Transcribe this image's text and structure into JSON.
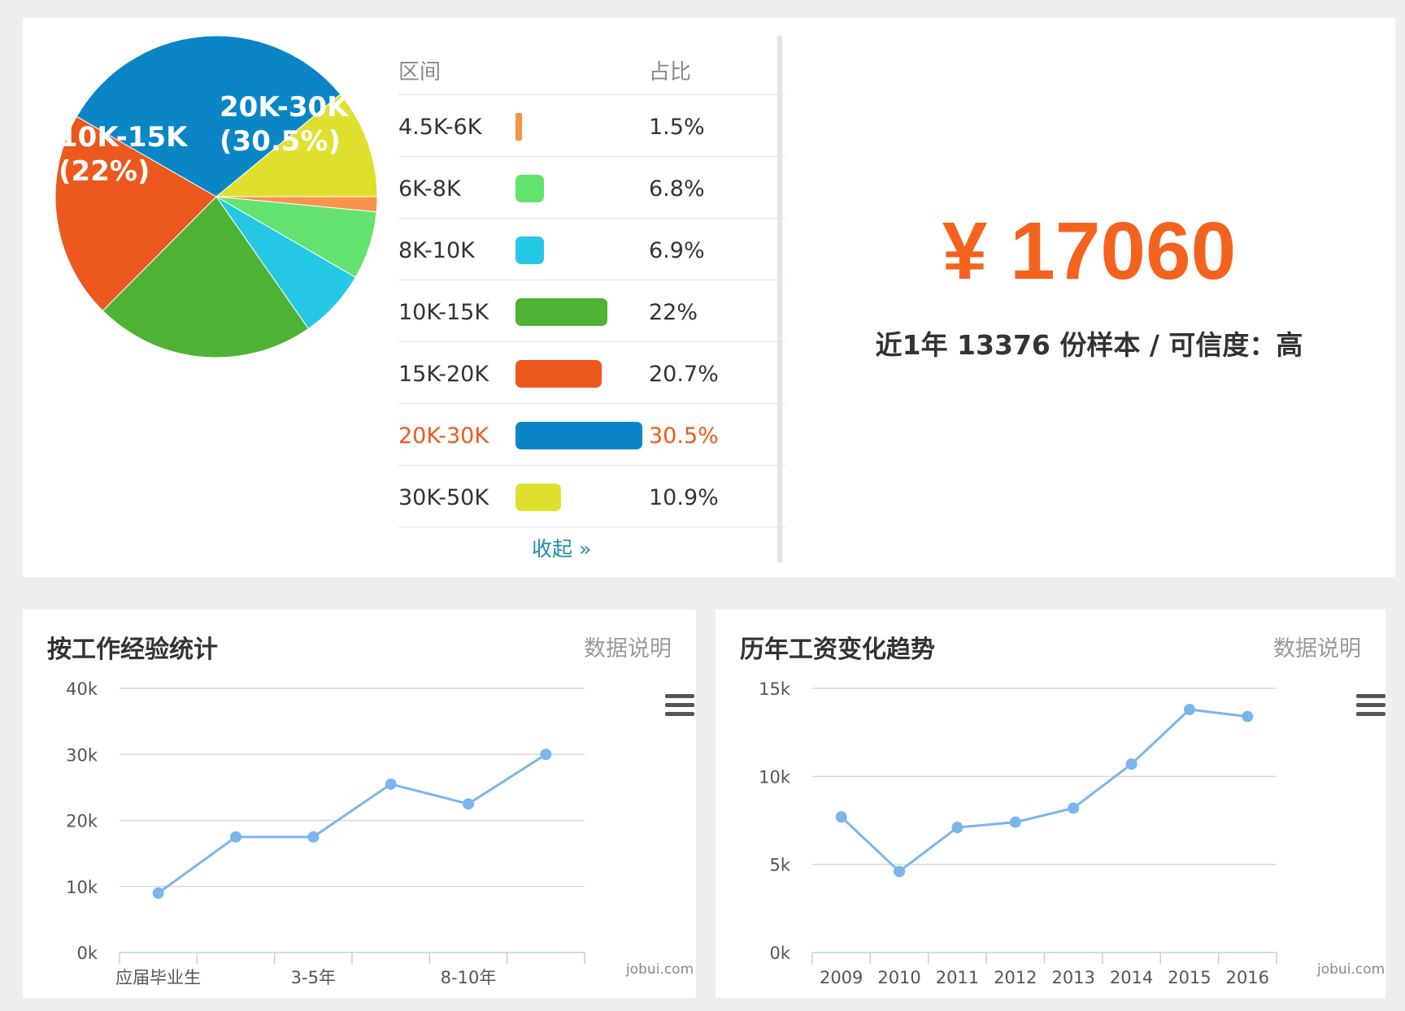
{
  "distribution": {
    "table_headers": {
      "range": "区间",
      "ratio": "占比"
    },
    "rows": [
      {
        "label": "4.5K-6K",
        "pct_text": "1.5%",
        "value": 1.5,
        "color": "#f7934a",
        "highlight": false
      },
      {
        "label": "6K-8K",
        "pct_text": "6.8%",
        "value": 6.8,
        "color": "#64e26f",
        "highlight": false
      },
      {
        "label": "8K-10K",
        "pct_text": "6.9%",
        "value": 6.9,
        "color": "#25c9e5",
        "highlight": false
      },
      {
        "label": "10K-15K",
        "pct_text": "22%",
        "value": 22,
        "color": "#4eb234",
        "highlight": false
      },
      {
        "label": "15K-20K",
        "pct_text": "20.7%",
        "value": 20.7,
        "color": "#ec581e",
        "highlight": false
      },
      {
        "label": "20K-30K",
        "pct_text": "30.5%",
        "value": 30.5,
        "color": "#0a86c7",
        "highlight": true
      },
      {
        "label": "30K-50K",
        "pct_text": "10.9%",
        "value": 10.9,
        "color": "#dfe02d",
        "highlight": false
      }
    ],
    "pie_labels": {
      "a_name": "20K-30K",
      "a_pct": "(30.5%)",
      "b_name": "10K-15K",
      "b_pct": "(22%)"
    },
    "collapse_label": "收起 »"
  },
  "summary": {
    "salary": "¥ 17060",
    "sample_text": "近1年 13376 份样本 / 可信度：高"
  },
  "experience_chart": {
    "title": "按工作经验统计",
    "note": "数据说明",
    "watermark": "jobui.com"
  },
  "trend_chart": {
    "title": "历年工资变化趋势",
    "note": "数据说明",
    "watermark": "jobui.com"
  },
  "chart_data": [
    {
      "type": "pie",
      "labels": [
        "4.5K-6K",
        "6K-8K",
        "8K-10K",
        "10K-15K",
        "15K-20K",
        "20K-30K",
        "30K-50K"
      ],
      "values": [
        1.5,
        6.8,
        6.9,
        22,
        20.7,
        30.5,
        10.9
      ]
    },
    {
      "type": "line",
      "title": "按工作经验统计",
      "x_ticklabels": [
        "应届毕业生",
        "",
        "3-5年",
        "",
        "8-10年",
        ""
      ],
      "values": [
        9000,
        17500,
        17500,
        25500,
        22500,
        30000
      ],
      "y_ticks": [
        "0k",
        "10k",
        "20k",
        "30k",
        "40k"
      ],
      "ylim": [
        0,
        40000
      ],
      "color": "#7cb5ec"
    },
    {
      "type": "line",
      "title": "历年工资变化趋势",
      "categories": [
        "2009",
        "2010",
        "2011",
        "2012",
        "2013",
        "2014",
        "2015",
        "2016"
      ],
      "values": [
        7700,
        4600,
        7100,
        7400,
        8200,
        10700,
        13800,
        13400
      ],
      "y_ticks": [
        "0k",
        "5k",
        "10k",
        "15k"
      ],
      "ylim": [
        0,
        15000
      ],
      "color": "#7cb5ec"
    }
  ]
}
